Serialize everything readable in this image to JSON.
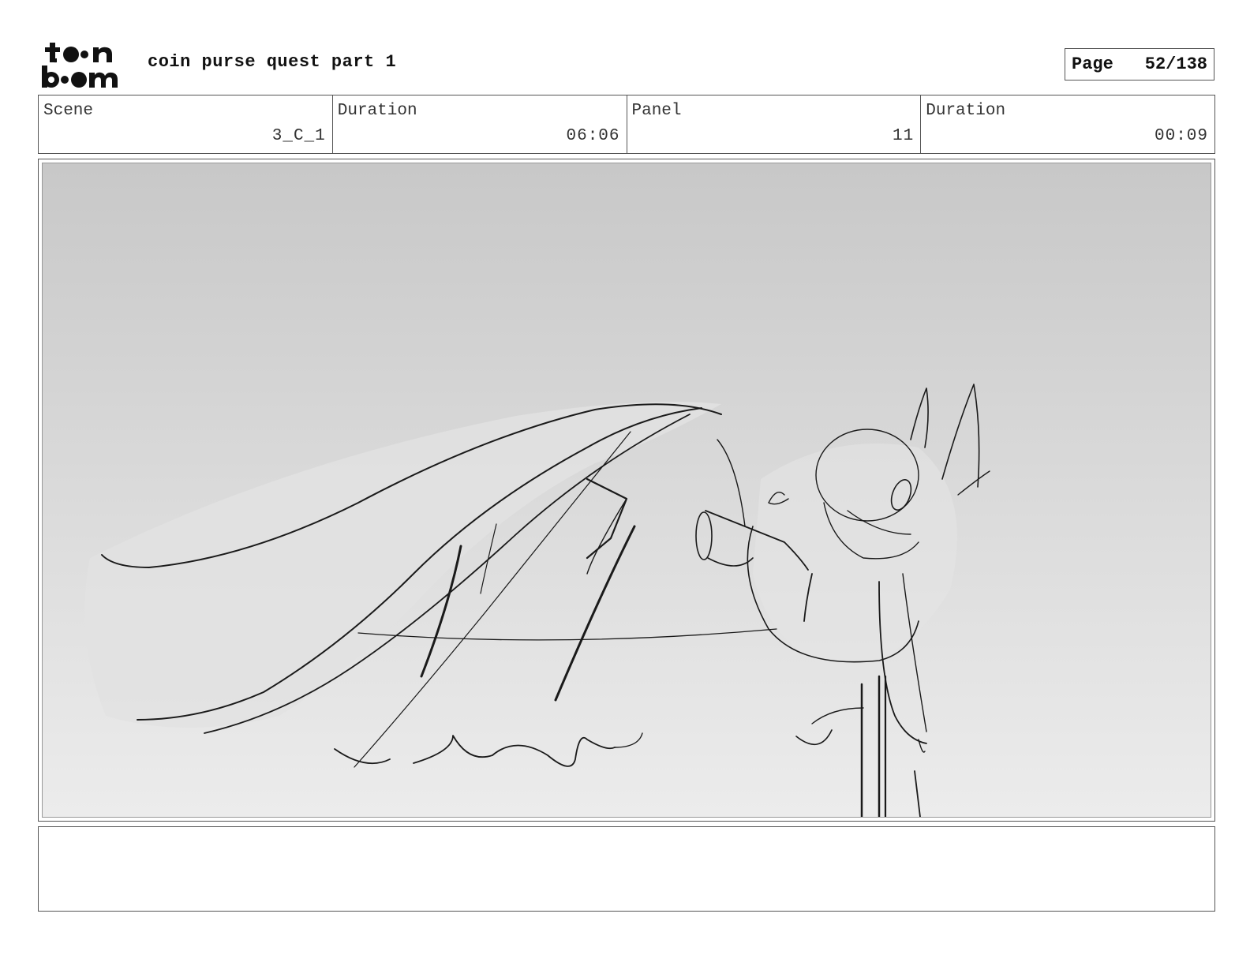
{
  "header": {
    "logo_text": "toon boom",
    "title": "coin purse quest part 1",
    "page_label": "Page",
    "page_value": "52/138"
  },
  "info": [
    {
      "label": "Scene",
      "value": "3_C_1"
    },
    {
      "label": "Duration",
      "value": "06:06"
    },
    {
      "label": "Panel",
      "value": "11"
    },
    {
      "label": "Duration",
      "value": "00:09"
    }
  ],
  "panel": {
    "icon": "storyboard-sketch",
    "colors": {
      "sky_top": "#c8c8c8",
      "sky_bottom": "#ececec",
      "line": "#1a1a1a"
    }
  },
  "notes": {
    "text": ""
  }
}
